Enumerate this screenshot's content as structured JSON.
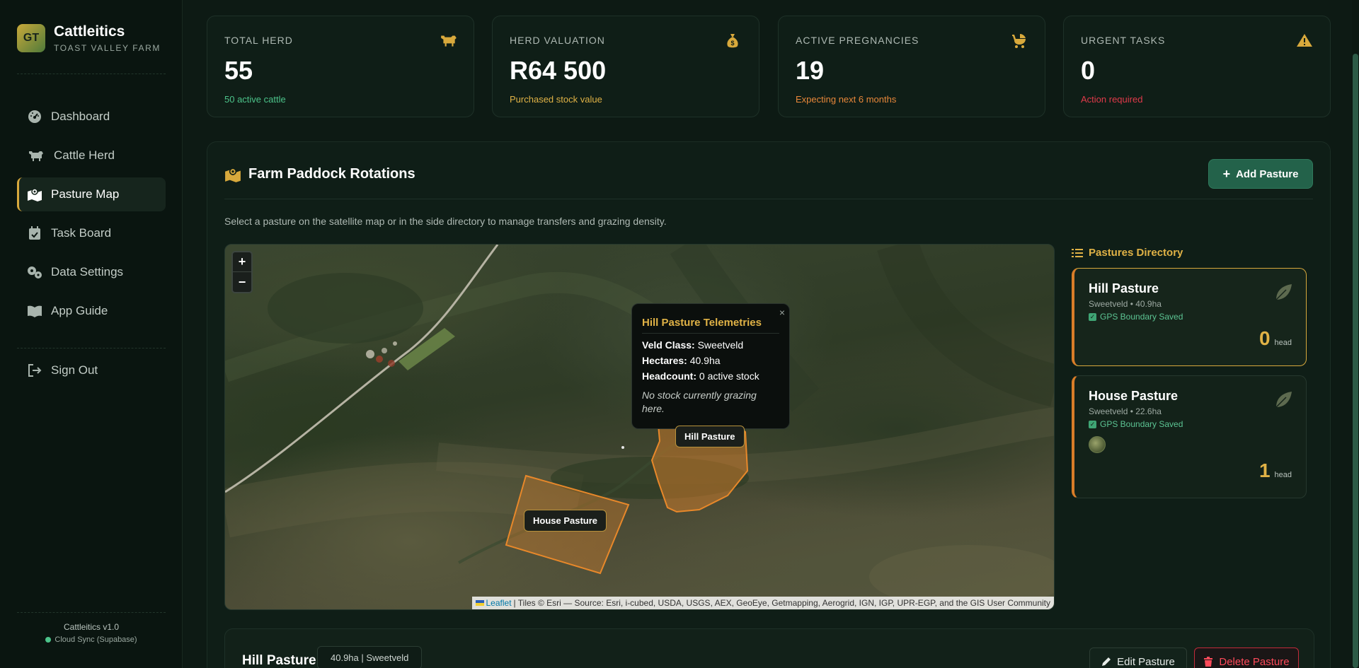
{
  "brand": {
    "logo_initials": "GT",
    "name": "Cattleitics",
    "subtitle": "TOAST VALLEY FARM"
  },
  "nav": {
    "items": [
      {
        "label": "Dashboard",
        "icon": "dashboard-gauge-icon"
      },
      {
        "label": "Cattle Herd",
        "icon": "cow-icon"
      },
      {
        "label": "Pasture Map",
        "icon": "map-icon",
        "active": true
      },
      {
        "label": "Task Board",
        "icon": "calendar-check-icon"
      },
      {
        "label": "Data Settings",
        "icon": "gears-icon"
      },
      {
        "label": "App Guide",
        "icon": "book-icon"
      }
    ],
    "sign_out": "Sign Out"
  },
  "footer": {
    "version": "Cattleitics v1.0",
    "sync": "Cloud Sync (Supabase)",
    "sync_color": "#4cc38a"
  },
  "stats": [
    {
      "label": "TOTAL HERD",
      "value": "55",
      "sub": "50 active cattle",
      "sub_color": "#4cc38a",
      "icon": "cow-icon"
    },
    {
      "label": "HERD VALUATION",
      "value": "R64 500",
      "sub": "Purchased stock value",
      "sub_color": "#e0b246",
      "icon": "money-bag-icon"
    },
    {
      "label": "ACTIVE PREGNANCIES",
      "value": "19",
      "sub": "Expecting next 6 months",
      "sub_color": "#e8873a",
      "icon": "baby-carriage-icon"
    },
    {
      "label": "URGENT TASKS",
      "value": "0",
      "sub": "Action required",
      "sub_color": "#e03a4a",
      "icon": "warning-icon"
    }
  ],
  "panel": {
    "title": "Farm Paddock Rotations",
    "add_button": "Add Pasture",
    "description": "Select a pasture on the satellite map or in the side directory to manage transfers and grazing density."
  },
  "map": {
    "zoom_in": "+",
    "zoom_out": "−",
    "popup": {
      "close": "×",
      "title": "Hill Pasture Telemetries",
      "veld_label": "Veld Class:",
      "veld_value": "Sweetveld",
      "hectares_label": "Hectares:",
      "hectares_value": "40.9ha",
      "headcount_label": "Headcount:",
      "headcount_value": "0 active stock",
      "note": "No stock currently grazing here."
    },
    "labels": {
      "hill": "Hill Pasture",
      "house": "House Pasture"
    },
    "attribution": {
      "leaflet": "Leaflet",
      "text": "| Tiles © Esri — Source: Esri, i-cubed, USDA, USGS, AEX, GeoEye, Getmapping, Aerogrid, IGN, IGP, UPR-EGP, and the GIS User Community"
    },
    "pasture_color": "#e8882a"
  },
  "directory": {
    "title": "Pastures Directory",
    "pastures": [
      {
        "name": "Hill Pasture",
        "meta": "Sweetveld • 40.9ha",
        "gps": "GPS Boundary Saved",
        "head": "0",
        "head_label": "head",
        "selected": true
      },
      {
        "name": "House Pasture",
        "meta": "Sweetveld • 22.6ha",
        "gps": "GPS Boundary Saved",
        "head": "1",
        "head_label": "head",
        "selected": false
      }
    ]
  },
  "detail": {
    "name": "Hill Pasture",
    "chip": "40.9ha | Sweetveld",
    "edit": "Edit Pasture",
    "delete": "Delete Pasture"
  },
  "colors": {
    "accent": "#d8a93c",
    "primary_button": "#23624a",
    "danger": "#e03a4a",
    "background": "#0d1a14"
  }
}
